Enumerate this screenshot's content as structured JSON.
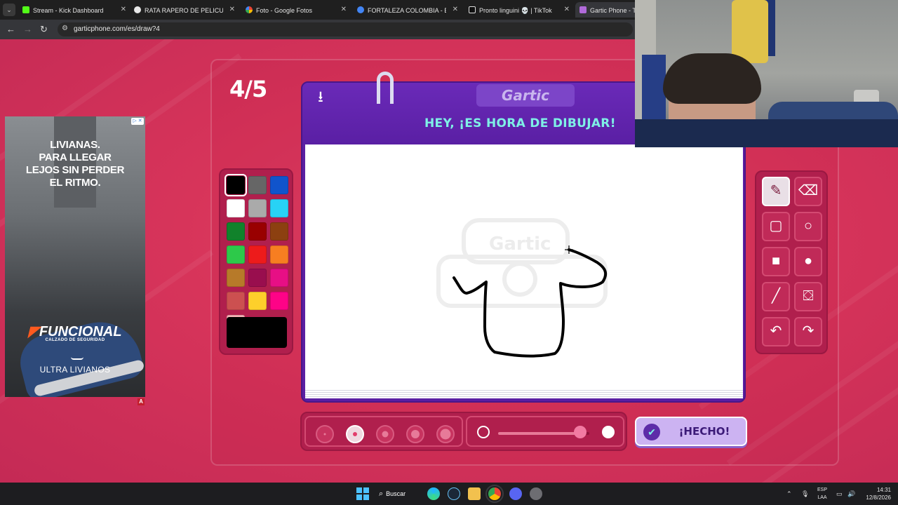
{
  "browser": {
    "tabs": [
      {
        "title": "Stream - Kick Dashboard",
        "fav_color": "#53fc18"
      },
      {
        "title": "RATA RAPERO DE PELICULA DE",
        "fav_color": "#e8e8e8"
      },
      {
        "title": "Foto - Google Fotos",
        "fav_color": "#fbbc04"
      },
      {
        "title": "FORTALEZA COLOMBIA - Buscar",
        "fav_color": "#4285f4"
      },
      {
        "title": "Pronto linguini 💀 | TikTok",
        "fav_color": "#111111"
      },
      {
        "title": "Gartic Phone - Tele",
        "fav_color": "#b06ad9"
      }
    ],
    "url": "garticphone.com/es/draw?4"
  },
  "game": {
    "round": "4/5",
    "logo": "Gartic",
    "prompt": "HEY, ¡ES HORA DE DIBUJAR!",
    "done_label": "¡HECHO!",
    "colors": [
      "#000000",
      "#666666",
      "#1054cc",
      "#ffffff",
      "#aaaaaa",
      "#28d2f5",
      "#11822b",
      "#990000",
      "#8c4010",
      "#2dc94a",
      "#ed1b1b",
      "#f77e21",
      "#b77a29",
      "#990e4e",
      "#e70f85",
      "#cc5050",
      "#fdd02b",
      "#fe0387",
      "#f8b4b8"
    ],
    "selected_color": "#000000",
    "brush_sizes": [
      1,
      2,
      3,
      4,
      5
    ],
    "selected_size_index": 1,
    "opacity_fraction": 0.9
  },
  "ad": {
    "headline": "LIVIANAS.\nPARA LLEGAR\nLEJOS SIN PERDER\nEL RITMO.",
    "brand": "FUNCIONAL",
    "subline": "CALZADO DE SEGURIDAD",
    "tagline": "ULTRA LIVIANOS",
    "badge": "A"
  },
  "taskbar": {
    "search_label": "Buscar",
    "lang_line1": "ESP",
    "lang_line2": "LAA",
    "time": "14:31",
    "date": "12/8/2026"
  }
}
